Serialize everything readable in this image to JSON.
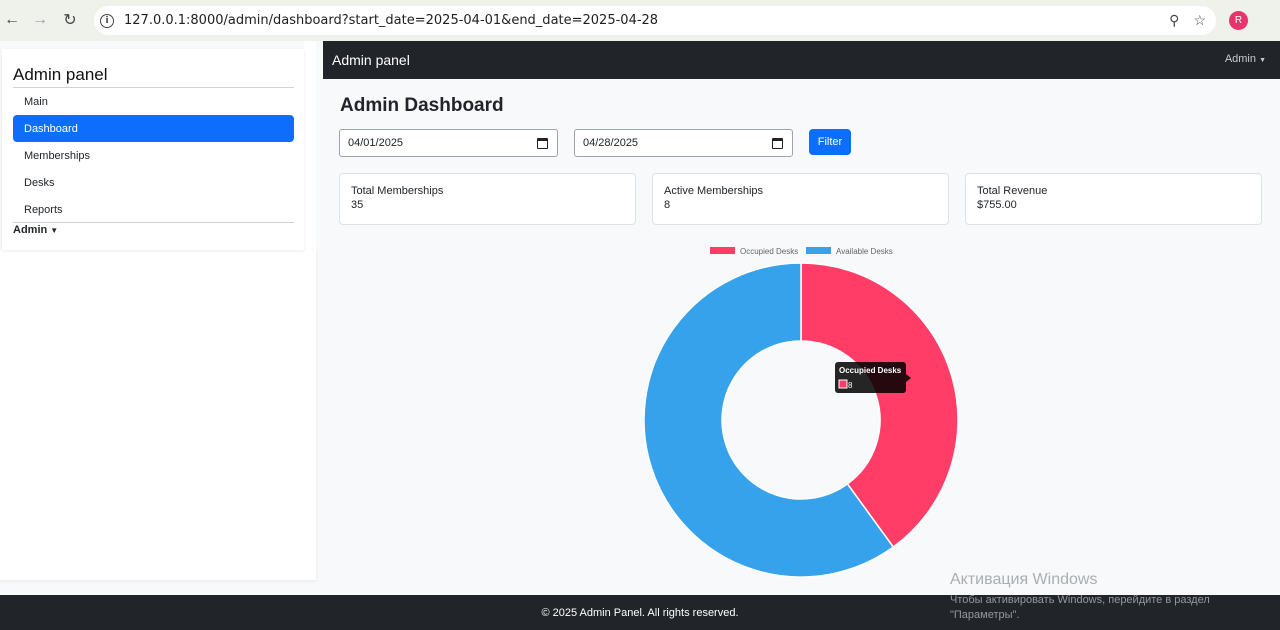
{
  "browser": {
    "url": "127.0.0.1:8000/admin/dashboard?start_date=2025-04-01&end_date=2025-04-28",
    "avatar_letter": "R"
  },
  "sidebar": {
    "title": "Admin panel",
    "items": [
      {
        "label": "Main",
        "active": false
      },
      {
        "label": "Dashboard",
        "active": true
      },
      {
        "label": "Memberships",
        "active": false
      },
      {
        "label": "Desks",
        "active": false
      },
      {
        "label": "Reports",
        "active": false
      }
    ],
    "admin_label": "Admin"
  },
  "topnav": {
    "brand": "Admin panel",
    "admin_label": "Admin"
  },
  "main": {
    "title": "Admin Dashboard",
    "start_date": "04/01/2025",
    "end_date": "04/28/2025",
    "filter_label": "Filter",
    "cards": [
      {
        "label": "Total Memberships",
        "value": "35"
      },
      {
        "label": "Active Memberships",
        "value": "8"
      },
      {
        "label": "Total Revenue",
        "value": "$755.00"
      }
    ]
  },
  "chart_data": {
    "type": "pie",
    "variant": "doughnut",
    "categories": [
      "Occupied Desks",
      "Available Desks"
    ],
    "values": [
      8,
      12
    ],
    "colors": [
      "#ff3d67",
      "#36a2eb"
    ],
    "legend": "top",
    "tooltip": {
      "title": "Occupied Desks",
      "value": "8"
    }
  },
  "footer": {
    "text": "© 2025 Admin Panel. All rights reserved."
  },
  "watermark": {
    "title": "Активация Windows",
    "line1": "Чтобы активировать Windows, перейдите в раздел",
    "line2": "\"Параметры\"."
  }
}
